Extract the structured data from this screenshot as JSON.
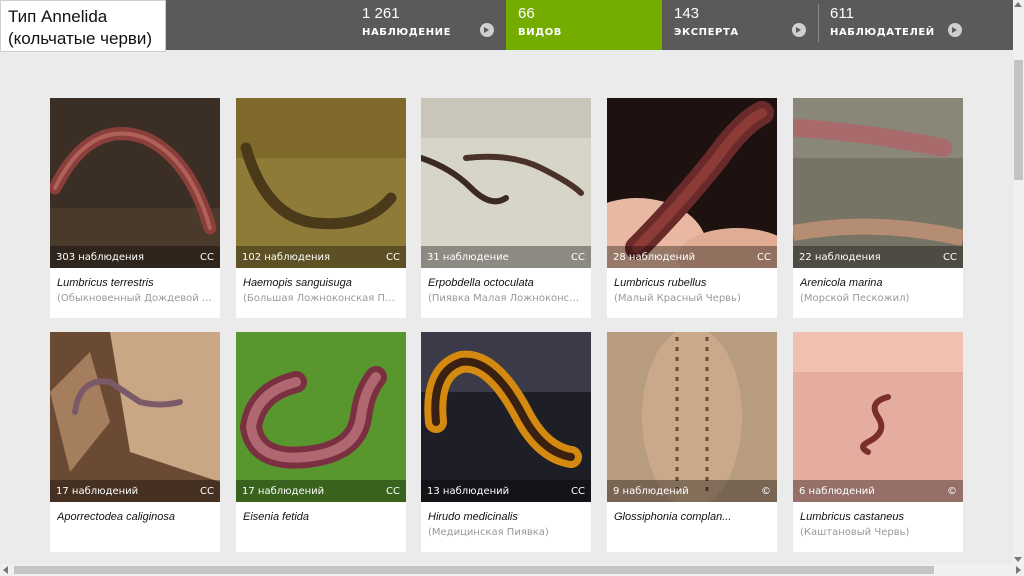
{
  "header": {
    "title_line1": "Тип Annelida",
    "title_line2": "(кольчатые черви)",
    "stats": [
      {
        "number": "1 261",
        "label": "НАБЛЮДЕНИЕ"
      },
      {
        "number": "66",
        "label": "ВИДОВ"
      },
      {
        "number": "143",
        "label": "ЭКСПЕРТА"
      },
      {
        "number": "611",
        "label": "НАБЛЮДАТЕЛЕЙ"
      }
    ]
  },
  "colors": {
    "accent": "#74ac00",
    "header_bg": "#5a5a5a",
    "page_bg": "#ebebeb"
  },
  "cards": [
    {
      "count": "303 наблюдения",
      "license": "CC",
      "sci": "Lumbricus terrestris",
      "common": "(Обыкновенный Дождевой Червь)"
    },
    {
      "count": "102 наблюдения",
      "license": "CC",
      "sci": "Haemopis sanguisuga",
      "common": "(Большая Ложноконская Пиявка)"
    },
    {
      "count": "31 наблюдение",
      "license": "CC",
      "sci": "Erpobdella octoculata",
      "common": "(Пиявка Малая Ложноконская)"
    },
    {
      "count": "28 наблюдений",
      "license": "CC",
      "sci": "Lumbricus rubellus",
      "common": "(Малый Красный Червь)"
    },
    {
      "count": "22 наблюдения",
      "license": "CC",
      "sci": "Arenicola marina",
      "common": "(Морской Пескожил)"
    },
    {
      "count": "17 наблюдений",
      "license": "CC",
      "sci": "Aporrectodea caliginosa",
      "common": ""
    },
    {
      "count": "17 наблюдений",
      "license": "CC",
      "sci": "Eisenia fetida",
      "common": ""
    },
    {
      "count": "13 наблюдений",
      "license": "CC",
      "sci": "Hirudo medicinalis",
      "common": "(Медицинская Пиявка)"
    },
    {
      "count": "9 наблюдений",
      "license": "©",
      "sci": "Glossiphonia complan...",
      "common": ""
    },
    {
      "count": "6 наблюдений",
      "license": "©",
      "sci": "Lumbricus castaneus",
      "common": "(Каштановый Червь)"
    }
  ]
}
